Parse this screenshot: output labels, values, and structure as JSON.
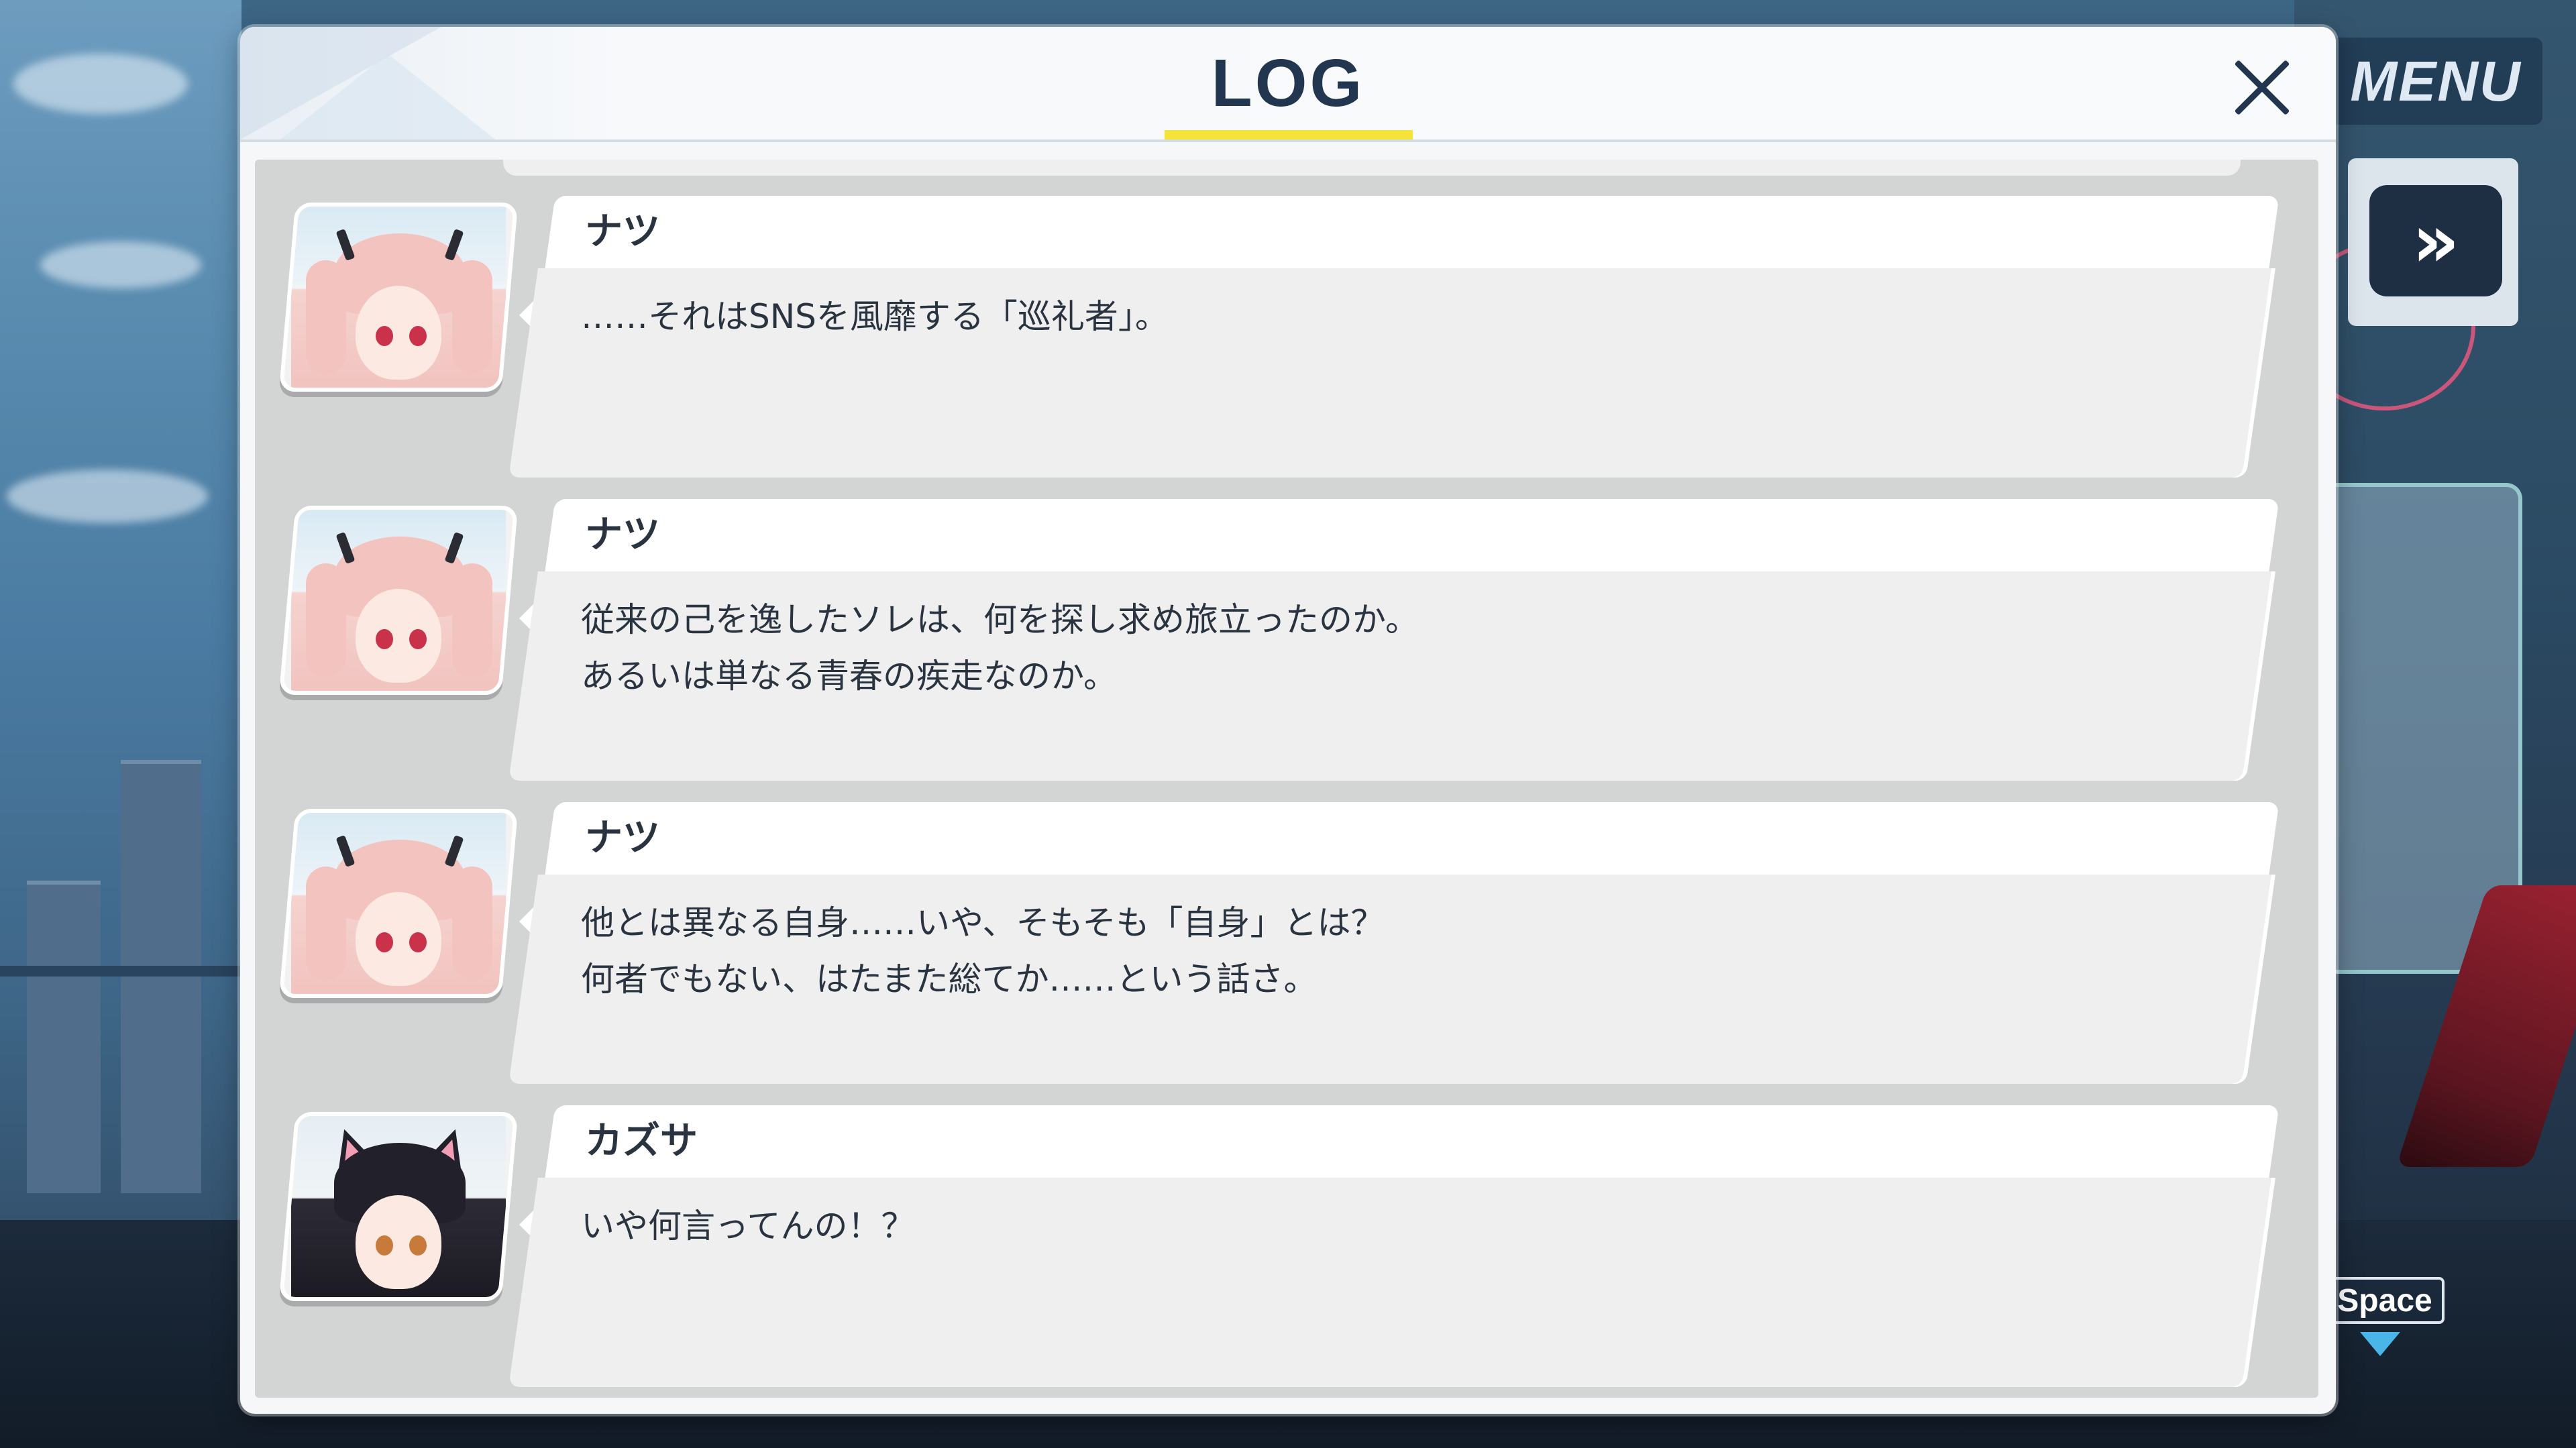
{
  "hud": {
    "menu_label": "MENU",
    "skip_label": "»",
    "space_label": "Space"
  },
  "log": {
    "title": "LOG",
    "close_label": "×",
    "entries": [
      {
        "speaker": "ナツ",
        "text": "……それはSNSを風靡する「巡礼者」。"
      },
      {
        "speaker": "ナツ",
        "text": "従来の己を逸したソレは、何を探し求め旅立ったのか。\nあるいは単なる青春の疾走なのか。"
      },
      {
        "speaker": "ナツ",
        "text": "他とは異なる自身……いや、そもそも「自身」とは？\n何者でもない、はたまた総てか……という話さ。"
      },
      {
        "speaker": "カズサ",
        "text": "いや何言ってんの！？"
      }
    ]
  },
  "colors": {
    "title_underline": "#f5e33a",
    "title_text": "#23364f",
    "skip_button": "#1f2f43",
    "space_arrow": "#4ab6e8"
  }
}
